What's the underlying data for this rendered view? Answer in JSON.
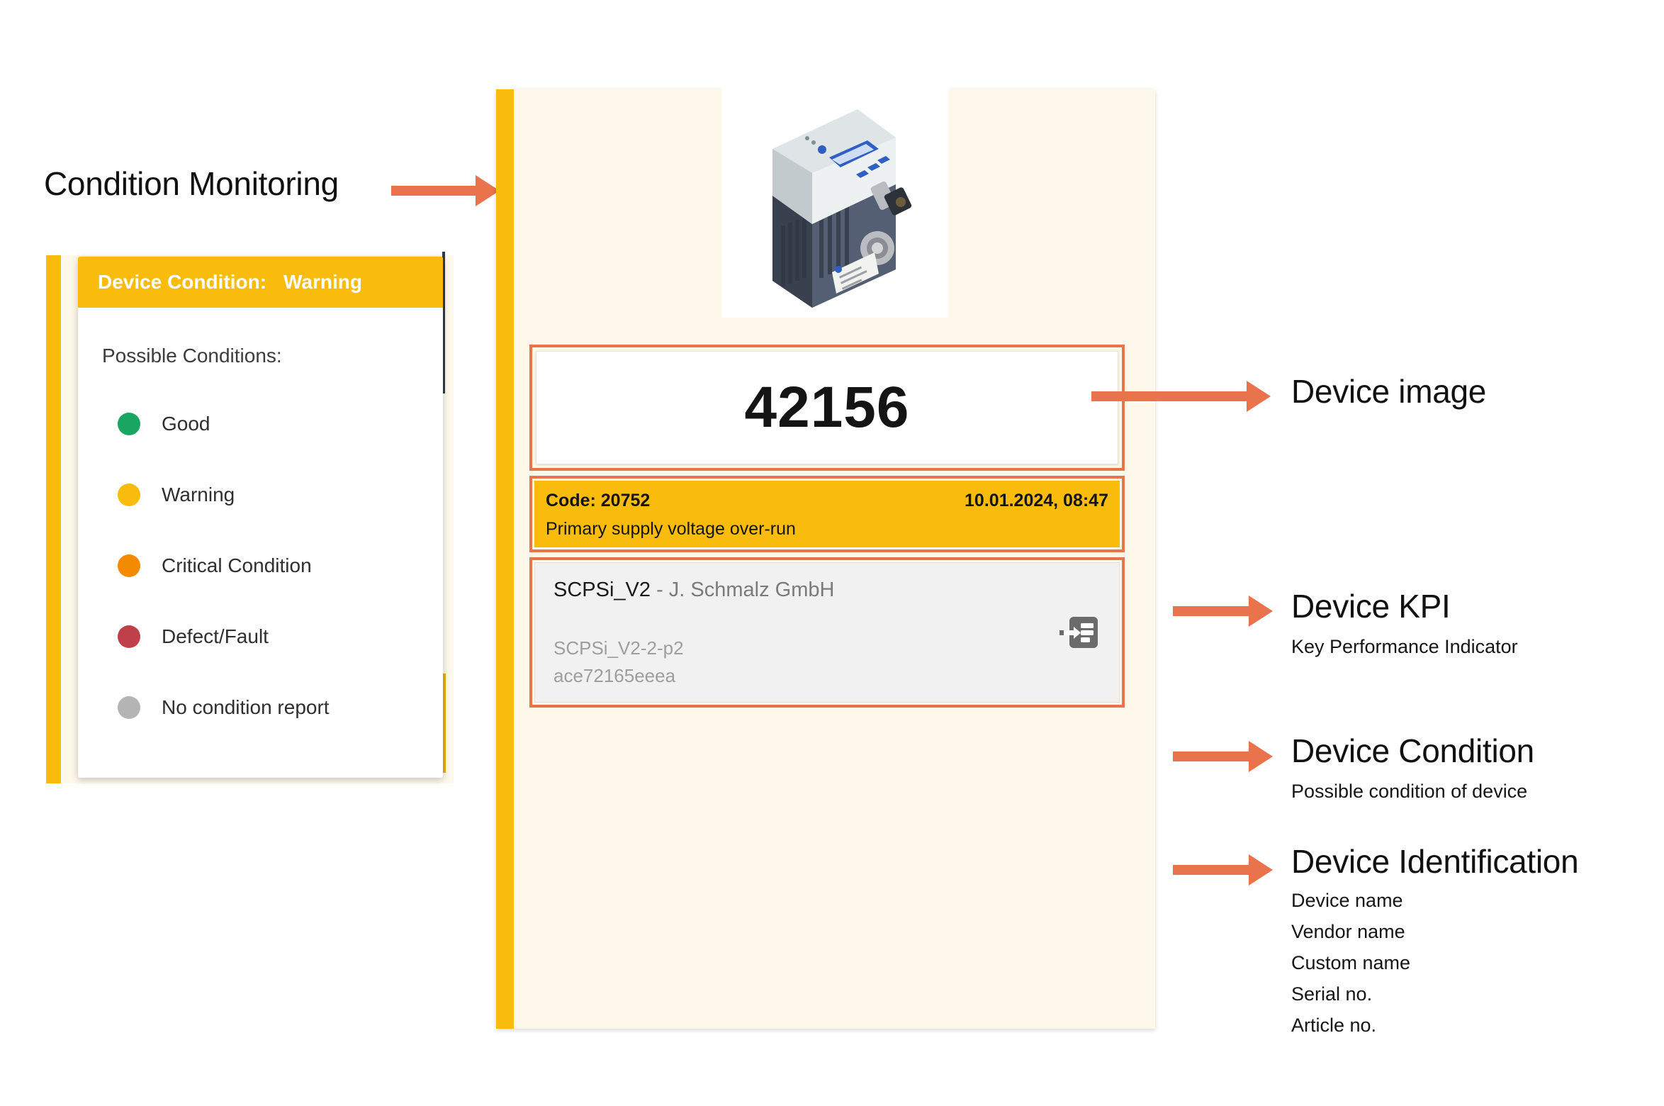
{
  "annotations": {
    "condition_monitoring": {
      "title": "Condition Monitoring"
    },
    "device_image": {
      "title": "Device image"
    },
    "device_kpi": {
      "title": "Device KPI",
      "subtitle": "Key Performance Indicator"
    },
    "device_condition": {
      "title": "Device Condition",
      "subtitle": "Possible condition of device"
    },
    "device_identification": {
      "title": "Device Identification",
      "lines": [
        "Device name",
        "Vendor name",
        "Custom name",
        "Serial no.",
        "Article no."
      ]
    }
  },
  "device_card": {
    "image_alt": "vacuum-ejector-device-photo",
    "kpi": {
      "value": "42156"
    },
    "condition": {
      "code_label": "Code: 20752",
      "timestamp": "10.01.2024, 08:47",
      "description": "Primary supply voltage over-run",
      "color": "#f9bc0d"
    },
    "identification": {
      "device_name": "SCPSi_V2",
      "separator": " - ",
      "vendor_name": "J. Schmalz GmbH",
      "custom_name": "SCPSi_V2-2-p2",
      "serial_no": "ace72165eeea",
      "detail_icon": "device-details-icon"
    },
    "accent_color": "#f9bc0d"
  },
  "condition_popup": {
    "header": {
      "label": "Device Condition:",
      "value": "Warning"
    },
    "body_title": "Possible Conditions:",
    "conditions": [
      {
        "label": "Good",
        "color": "#18a661"
      },
      {
        "label": "Warning",
        "color": "#f9bc0d"
      },
      {
        "label": "Critical Condition",
        "color": "#f38b00"
      },
      {
        "label": "Defect/Fault",
        "color": "#c0404a"
      },
      {
        "label": "No condition report",
        "color": "#b4b4b4"
      }
    ]
  },
  "colors": {
    "arrow": "#e8734c",
    "highlight_border": "#e8734c",
    "card_background": "#fdf8ea",
    "accent_yellow": "#f9bc0d"
  }
}
